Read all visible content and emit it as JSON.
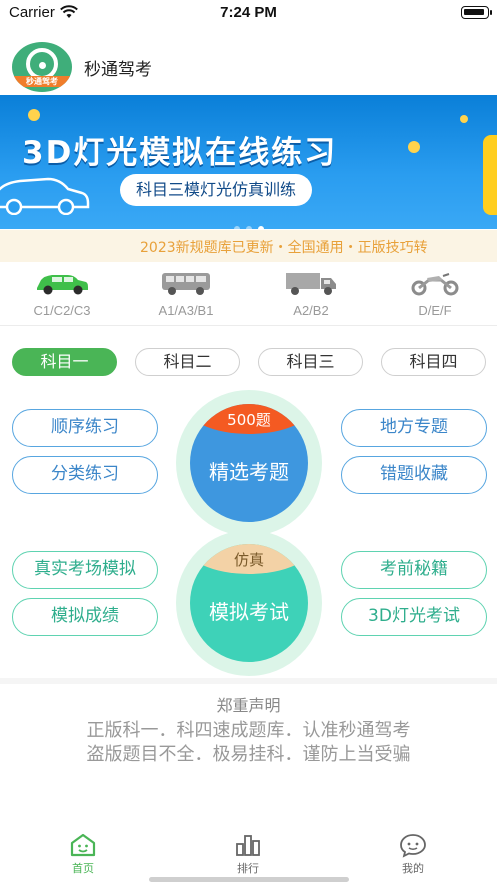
{
  "status_bar": {
    "carrier": "Carrier",
    "time": "7:24 PM",
    "battery_level": 0.85
  },
  "app": {
    "title": "秒通驾考",
    "logo_text": "秒通驾考"
  },
  "banner": {
    "title": "3D灯光模拟在线练习",
    "subtitle": "科目三模灯光仿真训练",
    "pages": 3,
    "active_page": 3
  },
  "marquee": {
    "text": "2023新规题库已更新・全国通用・正版技巧转"
  },
  "vehicles": [
    {
      "icon": "car-icon",
      "label": "C1/C2/C3"
    },
    {
      "icon": "bus-icon",
      "label": "A1/A3/B1"
    },
    {
      "icon": "truck-icon",
      "label": "A2/B2"
    },
    {
      "icon": "motorcycle-icon",
      "label": "D/E/F"
    }
  ],
  "subject_tabs": [
    {
      "label": "科目一",
      "active": true
    },
    {
      "label": "科目二",
      "active": false
    },
    {
      "label": "科目三",
      "active": false
    },
    {
      "label": "科目四",
      "active": false
    }
  ],
  "practice": {
    "left_top": "顺序练习",
    "left_bottom": "分类练习",
    "right_top": "地方专题",
    "right_bottom": "错题收藏",
    "center_label": "精选考题",
    "center_badge": "500题"
  },
  "exam": {
    "left_top": "真实考场模拟",
    "left_bottom": "模拟成绩",
    "right_top": "考前秘籍",
    "right_bottom": "3D灯光考试",
    "center_label": "模拟考试",
    "center_badge": "仿真"
  },
  "notice": {
    "title": "郑重声明",
    "line1": "正版科一．科四速成题库．认准秒通驾考",
    "line2": "盗版题目不全．极易挂科．谨防上当受骗"
  },
  "tabbar": [
    {
      "icon": "home-icon",
      "label": "首页",
      "active": true
    },
    {
      "icon": "ranking-icon",
      "label": "排行",
      "active": false
    },
    {
      "icon": "profile-icon",
      "label": "我的",
      "active": false
    }
  ],
  "colors": {
    "accent_green": "#4ab556",
    "banner_blue": "#0a7fd8",
    "practice_blue": "#3b86c9",
    "exam_teal": "#2fae8d",
    "marquee_text": "#e8a13a"
  }
}
